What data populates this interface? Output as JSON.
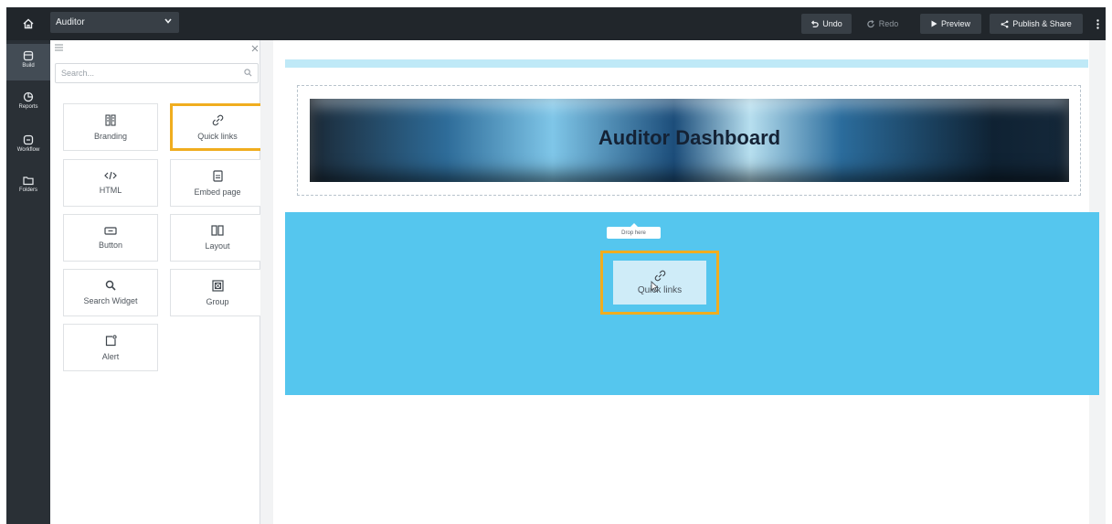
{
  "topbar": {
    "home_icon": "home-icon",
    "app_name": "Auditor",
    "undo": "Undo",
    "redo": "Redo",
    "preview": "Preview",
    "publish": "Publish & Share"
  },
  "rail": {
    "items": [
      {
        "label": "Build",
        "icon": "build-icon"
      },
      {
        "label": "Reports",
        "icon": "reports-icon"
      },
      {
        "label": "Workflow",
        "icon": "workflow-icon"
      },
      {
        "label": "Folders",
        "icon": "folder-icon"
      }
    ]
  },
  "panel": {
    "search_placeholder": "Search...",
    "widgets": [
      {
        "label": "Branding",
        "icon": "branding-icon"
      },
      {
        "label": "Quick links",
        "icon": "link-icon",
        "selected": true
      },
      {
        "label": "HTML",
        "icon": "code-icon"
      },
      {
        "label": "Embed page",
        "icon": "embed-page-icon"
      },
      {
        "label": "Button",
        "icon": "button-icon"
      },
      {
        "label": "Layout",
        "icon": "layout-icon"
      },
      {
        "label": "Search Widget",
        "icon": "search-icon"
      },
      {
        "label": "Group",
        "icon": "group-icon"
      },
      {
        "label": "Alert",
        "icon": "alert-icon"
      }
    ]
  },
  "canvas": {
    "banner_title": "Auditor Dashboard",
    "drop_label": "Drop here",
    "dragged_widget": "Quick links"
  },
  "colors": {
    "accent_highlight": "#f0ad1f",
    "dropzone": "#55c6ee",
    "topbar": "#21262b"
  }
}
